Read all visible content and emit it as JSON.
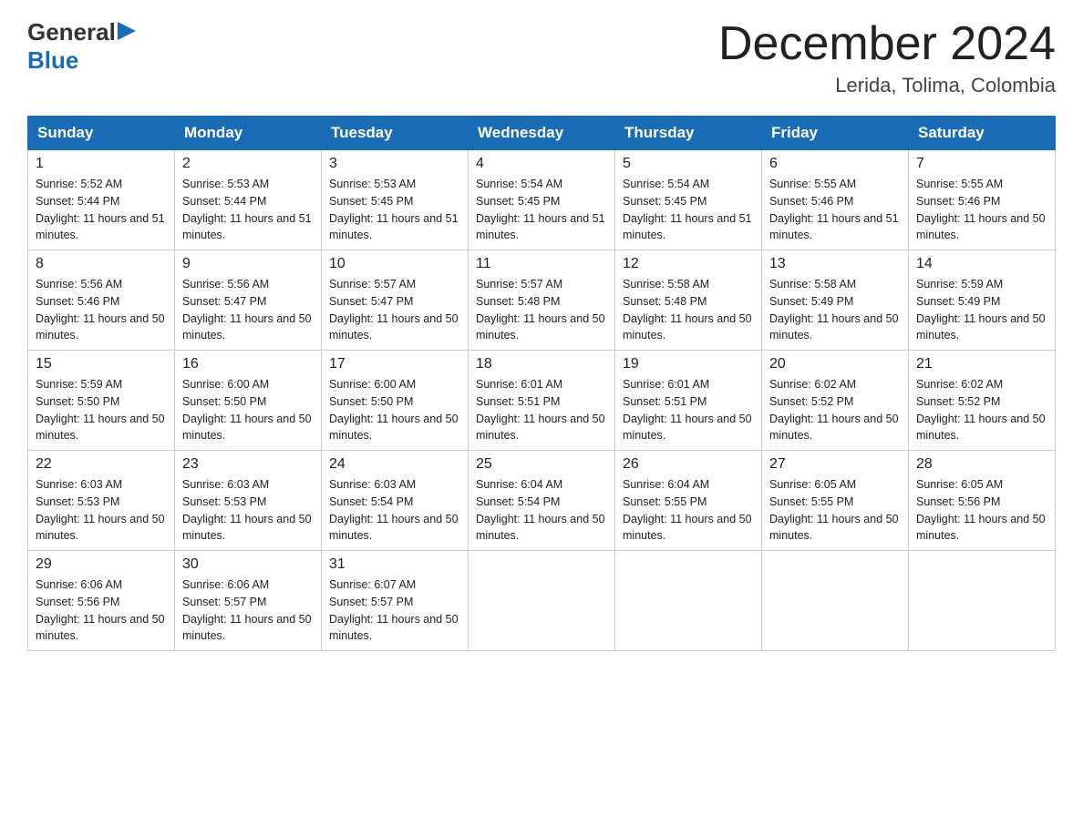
{
  "logo": {
    "text_general": "General",
    "text_blue": "Blue"
  },
  "title": {
    "month_year": "December 2024",
    "location": "Lerida, Tolima, Colombia"
  },
  "header_days": [
    "Sunday",
    "Monday",
    "Tuesday",
    "Wednesday",
    "Thursday",
    "Friday",
    "Saturday"
  ],
  "weeks": [
    [
      {
        "day": "1",
        "sunrise": "5:52 AM",
        "sunset": "5:44 PM",
        "daylight": "11 hours and 51 minutes."
      },
      {
        "day": "2",
        "sunrise": "5:53 AM",
        "sunset": "5:44 PM",
        "daylight": "11 hours and 51 minutes."
      },
      {
        "day": "3",
        "sunrise": "5:53 AM",
        "sunset": "5:45 PM",
        "daylight": "11 hours and 51 minutes."
      },
      {
        "day": "4",
        "sunrise": "5:54 AM",
        "sunset": "5:45 PM",
        "daylight": "11 hours and 51 minutes."
      },
      {
        "day": "5",
        "sunrise": "5:54 AM",
        "sunset": "5:45 PM",
        "daylight": "11 hours and 51 minutes."
      },
      {
        "day": "6",
        "sunrise": "5:55 AM",
        "sunset": "5:46 PM",
        "daylight": "11 hours and 51 minutes."
      },
      {
        "day": "7",
        "sunrise": "5:55 AM",
        "sunset": "5:46 PM",
        "daylight": "11 hours and 50 minutes."
      }
    ],
    [
      {
        "day": "8",
        "sunrise": "5:56 AM",
        "sunset": "5:46 PM",
        "daylight": "11 hours and 50 minutes."
      },
      {
        "day": "9",
        "sunrise": "5:56 AM",
        "sunset": "5:47 PM",
        "daylight": "11 hours and 50 minutes."
      },
      {
        "day": "10",
        "sunrise": "5:57 AM",
        "sunset": "5:47 PM",
        "daylight": "11 hours and 50 minutes."
      },
      {
        "day": "11",
        "sunrise": "5:57 AM",
        "sunset": "5:48 PM",
        "daylight": "11 hours and 50 minutes."
      },
      {
        "day": "12",
        "sunrise": "5:58 AM",
        "sunset": "5:48 PM",
        "daylight": "11 hours and 50 minutes."
      },
      {
        "day": "13",
        "sunrise": "5:58 AM",
        "sunset": "5:49 PM",
        "daylight": "11 hours and 50 minutes."
      },
      {
        "day": "14",
        "sunrise": "5:59 AM",
        "sunset": "5:49 PM",
        "daylight": "11 hours and 50 minutes."
      }
    ],
    [
      {
        "day": "15",
        "sunrise": "5:59 AM",
        "sunset": "5:50 PM",
        "daylight": "11 hours and 50 minutes."
      },
      {
        "day": "16",
        "sunrise": "6:00 AM",
        "sunset": "5:50 PM",
        "daylight": "11 hours and 50 minutes."
      },
      {
        "day": "17",
        "sunrise": "6:00 AM",
        "sunset": "5:50 PM",
        "daylight": "11 hours and 50 minutes."
      },
      {
        "day": "18",
        "sunrise": "6:01 AM",
        "sunset": "5:51 PM",
        "daylight": "11 hours and 50 minutes."
      },
      {
        "day": "19",
        "sunrise": "6:01 AM",
        "sunset": "5:51 PM",
        "daylight": "11 hours and 50 minutes."
      },
      {
        "day": "20",
        "sunrise": "6:02 AM",
        "sunset": "5:52 PM",
        "daylight": "11 hours and 50 minutes."
      },
      {
        "day": "21",
        "sunrise": "6:02 AM",
        "sunset": "5:52 PM",
        "daylight": "11 hours and 50 minutes."
      }
    ],
    [
      {
        "day": "22",
        "sunrise": "6:03 AM",
        "sunset": "5:53 PM",
        "daylight": "11 hours and 50 minutes."
      },
      {
        "day": "23",
        "sunrise": "6:03 AM",
        "sunset": "5:53 PM",
        "daylight": "11 hours and 50 minutes."
      },
      {
        "day": "24",
        "sunrise": "6:03 AM",
        "sunset": "5:54 PM",
        "daylight": "11 hours and 50 minutes."
      },
      {
        "day": "25",
        "sunrise": "6:04 AM",
        "sunset": "5:54 PM",
        "daylight": "11 hours and 50 minutes."
      },
      {
        "day": "26",
        "sunrise": "6:04 AM",
        "sunset": "5:55 PM",
        "daylight": "11 hours and 50 minutes."
      },
      {
        "day": "27",
        "sunrise": "6:05 AM",
        "sunset": "5:55 PM",
        "daylight": "11 hours and 50 minutes."
      },
      {
        "day": "28",
        "sunrise": "6:05 AM",
        "sunset": "5:56 PM",
        "daylight": "11 hours and 50 minutes."
      }
    ],
    [
      {
        "day": "29",
        "sunrise": "6:06 AM",
        "sunset": "5:56 PM",
        "daylight": "11 hours and 50 minutes."
      },
      {
        "day": "30",
        "sunrise": "6:06 AM",
        "sunset": "5:57 PM",
        "daylight": "11 hours and 50 minutes."
      },
      {
        "day": "31",
        "sunrise": "6:07 AM",
        "sunset": "5:57 PM",
        "daylight": "11 hours and 50 minutes."
      },
      null,
      null,
      null,
      null
    ]
  ]
}
